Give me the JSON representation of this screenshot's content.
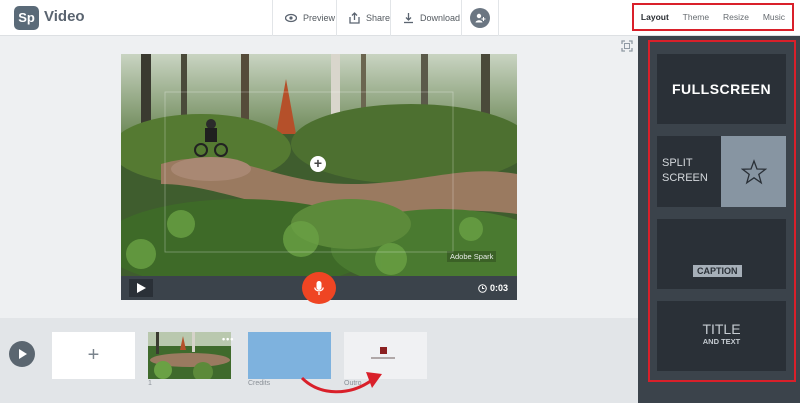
{
  "header": {
    "logo_text": "Sp",
    "app_name": "Video",
    "preview_label": "Preview",
    "share_label": "Share",
    "download_label": "Download"
  },
  "right_tabs": [
    {
      "label": "Layout",
      "active": true
    },
    {
      "label": "Theme",
      "active": false
    },
    {
      "label": "Resize",
      "active": false
    },
    {
      "label": "Music",
      "active": false
    }
  ],
  "layouts": {
    "fullscreen": "FULLSCREEN",
    "split_line1": "SPLIT",
    "split_line2": "SCREEN",
    "caption": "CAPTION",
    "title_main": "TITLE",
    "title_sub": "AND TEXT"
  },
  "player": {
    "watermark": "Adobe Spark",
    "time": "0:03"
  },
  "timeline": {
    "slide1_number": "1",
    "slide2_label": "Credits",
    "slide3_label": "Outro",
    "slide1_menu": "•••"
  },
  "colors": {
    "accent_red": "#d9202a",
    "mic_orange": "#ef4523",
    "panel_dark": "#3b434b",
    "credits_blue": "#7eb2de"
  },
  "icons": [
    "eye-icon",
    "share-icon",
    "download-icon",
    "user-add-icon",
    "fit-screen-icon",
    "star-icon",
    "play-icon",
    "mic-icon",
    "clock-icon",
    "plus-icon"
  ]
}
